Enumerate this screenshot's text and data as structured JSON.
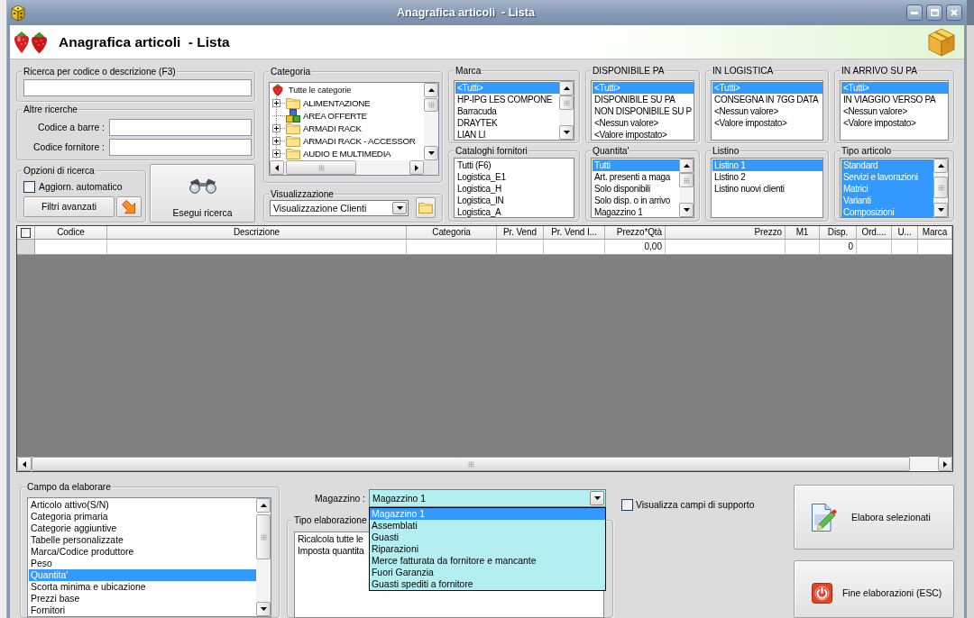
{
  "window": {
    "title": "Anagrafica articoli  - Lista"
  },
  "header": {
    "title": "Anagrafica articoli  - Lista"
  },
  "search": {
    "title": "Ricerca per codice o descrizione (F3)"
  },
  "other_searches": {
    "title": "Altre ricerche",
    "fields": [
      {
        "label": "Codice a barre :"
      },
      {
        "label": "Codice fornitore :"
      }
    ]
  },
  "search_options": {
    "title": "Opzioni di ricerca",
    "auto_update": {
      "label": "Aggiorn. automatico",
      "checked": false
    },
    "advanced_filters": {
      "label": "Filtri avanzati"
    }
  },
  "run_search": {
    "label": "Esegui ricerca"
  },
  "category": {
    "title": "Categoria",
    "tree": [
      {
        "label": "Tutte le categorie",
        "kind": "root",
        "children": [
          {
            "label": "ALIMENTAZIONE",
            "kind": "folder",
            "expanded": false
          },
          {
            "label": "AREA OFFERTE",
            "kind": "blocks"
          },
          {
            "label": "ARMADI RACK",
            "kind": "folder",
            "expanded": false
          },
          {
            "label": "ARMADI RACK - ACCESSOR",
            "kind": "folder",
            "expanded": false
          },
          {
            "label": "AUDIO E MULTIMEDIA",
            "kind": "folder",
            "expanded": false
          }
        ]
      }
    ]
  },
  "view": {
    "title": "Visualizzazione",
    "value": "Visualizzazione Clienti"
  },
  "filters": [
    {
      "title": "Marca",
      "kind": "scroll",
      "items": [
        {
          "label": "<Tutti>",
          "selected": true
        },
        {
          "label": "HP-IPG LES COMPONE",
          "selected": false
        },
        {
          "label": "Barracuda",
          "selected": false
        },
        {
          "label": "DRAYTEK",
          "selected": false
        },
        {
          "label": "LIAN LI",
          "selected": false
        }
      ]
    },
    {
      "title": "DISPONIBILE PA",
      "kind": "plain",
      "items": [
        {
          "label": "<Tutti>",
          "selected": true
        },
        {
          "label": "DISPONIBILE SU PA",
          "selected": false
        },
        {
          "label": "NON DISPONIBILE SU P",
          "selected": false
        },
        {
          "label": "<Nessun valore>",
          "selected": false
        },
        {
          "label": "<Valore impostato>",
          "selected": false
        }
      ]
    },
    {
      "title": "IN LOGISTICA",
      "kind": "plain",
      "items": [
        {
          "label": "<Tutti>",
          "selected": true
        },
        {
          "label": "CONSEGNA IN 7GG DATA",
          "selected": false
        },
        {
          "label": "<Nessun valore>",
          "selected": false
        },
        {
          "label": "<Valore impostato>",
          "selected": false
        }
      ]
    },
    {
      "title": "IN ARRIVO SU PA",
      "kind": "plain",
      "items": [
        {
          "label": "<Tutti>",
          "selected": true
        },
        {
          "label": "IN VIAGGIO VERSO PA",
          "selected": false
        },
        {
          "label": "<Nessun valore>",
          "selected": false
        },
        {
          "label": "<Valore impostato>",
          "selected": false
        }
      ]
    },
    {
      "title": "Cataloghi fornitori",
      "kind": "plain",
      "items": [
        {
          "label": "Tutti (F6)",
          "selected": false
        },
        {
          "label": "Logistica_E1",
          "selected": false
        },
        {
          "label": "Logistica_H",
          "selected": false
        },
        {
          "label": "Logistica_IN",
          "selected": false
        },
        {
          "label": "Logistica_A",
          "selected": false
        }
      ]
    },
    {
      "title": "Quantita'",
      "kind": "scroll",
      "items": [
        {
          "label": "Tutti",
          "selected": true
        },
        {
          "label": "Art. presenti a maga",
          "selected": false
        },
        {
          "label": "Solo disponibili",
          "selected": false
        },
        {
          "label": "Solo disp. o in arrivo",
          "selected": false
        },
        {
          "label": "Magazzino 1",
          "selected": false
        }
      ]
    },
    {
      "title": "Listino",
      "kind": "plain",
      "items": [
        {
          "label": "Listino 1",
          "selected": true
        },
        {
          "label": "Listino 2",
          "selected": false
        },
        {
          "label": "Listino nuovi clienti",
          "selected": false
        }
      ]
    },
    {
      "title": "Tipo articolo",
      "kind": "scroll",
      "items": [
        {
          "label": "Standard",
          "selected": true
        },
        {
          "label": "Servizi e lavorazioni",
          "selected": true
        },
        {
          "label": "Matrici",
          "selected": true
        },
        {
          "label": "Varianti",
          "selected": true
        },
        {
          "label": "Composizioni",
          "selected": true
        }
      ]
    }
  ],
  "table": {
    "select_all": {
      "checked": false
    },
    "columns": [
      {
        "label": "Codice",
        "kind": "text"
      },
      {
        "label": "Descrizione",
        "kind": "text"
      },
      {
        "label": "Categoria",
        "kind": "text"
      },
      {
        "label": "Pr. Vend",
        "kind": "text"
      },
      {
        "label": "Pr. Vend I...",
        "kind": "text"
      },
      {
        "label": "Prezzo*Qtà",
        "kind": "number",
        "row_value": "0,00"
      },
      {
        "label": "Prezzo",
        "kind": "number"
      },
      {
        "label": "M1",
        "kind": "text"
      },
      {
        "label": "Disp.",
        "kind": "text",
        "row_value": "0"
      },
      {
        "label": "Ord....",
        "kind": "text"
      },
      {
        "label": "U...",
        "kind": "text"
      },
      {
        "label": "Marca",
        "kind": "text"
      }
    ]
  },
  "process_field": {
    "title": "Campo da elaborare",
    "items": [
      {
        "label": "Articolo attivo(S/N)",
        "selected": false
      },
      {
        "label": "Categoria primaria",
        "selected": false
      },
      {
        "label": "Categorie aggiuntive",
        "selected": false
      },
      {
        "label": "Tabelle personalizzate",
        "selected": false
      },
      {
        "label": "Marca/Codice produttore",
        "selected": false
      },
      {
        "label": "Peso",
        "selected": false
      },
      {
        "label": "Quantita'",
        "selected": true
      },
      {
        "label": "Scorta minima e ubicazione",
        "selected": false
      },
      {
        "label": "Prezzi base",
        "selected": false
      },
      {
        "label": "Fornitori",
        "selected": false
      }
    ]
  },
  "warehouse": {
    "label": "Magazzino :",
    "value": "Magazzino 1",
    "expanded": true,
    "options": [
      {
        "label": "Magazzino 1",
        "selected": true
      },
      {
        "label": "Assemblati",
        "selected": false
      },
      {
        "label": "Guasti",
        "selected": false
      },
      {
        "label": "Riparazioni",
        "selected": false
      },
      {
        "label": "Merce fatturata da fornitore e mancante",
        "selected": false
      },
      {
        "label": "Fuori Garanzia",
        "selected": false
      },
      {
        "label": "Guasti spediti a fornitore",
        "selected": false
      }
    ]
  },
  "processing_type": {
    "title": "Tipo elaborazione",
    "items": [
      {
        "label": "Ricalcola tutte le",
        "selected": false
      },
      {
        "label": "Imposta quantita",
        "selected": false
      }
    ]
  },
  "support_fields": {
    "label": "Visualizza campi di supporto",
    "checked": false
  },
  "buttons": [
    {
      "label": "Elabora selezionati",
      "kind": "edit"
    },
    {
      "label": "Fine elaborazioni (ESC)",
      "kind": "exit"
    }
  ]
}
